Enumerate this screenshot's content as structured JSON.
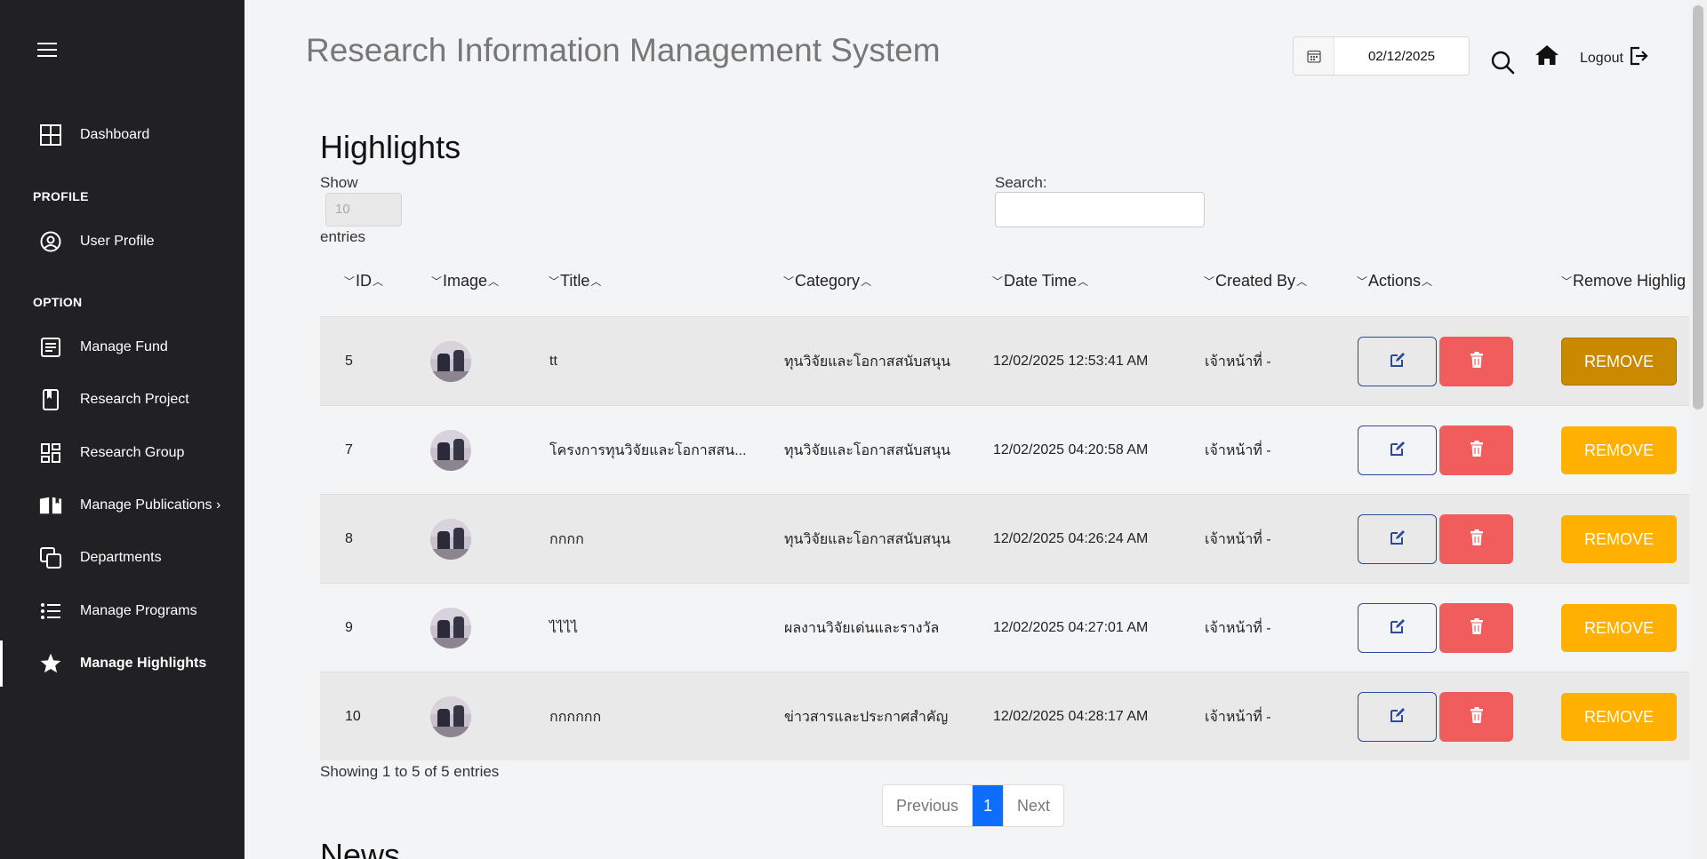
{
  "app": {
    "title": "Research Information Management System"
  },
  "topbar": {
    "date": "02/12/2025",
    "logout_label": "Logout"
  },
  "sidebar": {
    "sections": {
      "profile": "PROFILE",
      "option": "OPTION"
    },
    "items": [
      {
        "label": "Dashboard"
      },
      {
        "label": "User Profile"
      },
      {
        "label": "Manage Fund"
      },
      {
        "label": "Research Project"
      },
      {
        "label": "Research Group"
      },
      {
        "label": "Manage Publications ›"
      },
      {
        "label": "Departments"
      },
      {
        "label": "Manage Programs"
      },
      {
        "label": "Manage Highlights"
      }
    ]
  },
  "main": {
    "heading": "Highlights",
    "show_label": "Show",
    "show_value": "10",
    "entries_label": "entries",
    "search_label": "Search:",
    "search_value": "",
    "columns": [
      "ID",
      "Image",
      "Title",
      "Category",
      "Date Time",
      "Created By",
      "Actions",
      "Remove Highlig"
    ],
    "rows": [
      {
        "id": "5",
        "title": "tt",
        "category": "ทุนวิจัยและโอกาสสนับสนุน",
        "datetime": "12/02/2025 12:53:41 AM",
        "created_by": "เจ้าหน้าที่ -",
        "remove": "REMOVE"
      },
      {
        "id": "7",
        "title": "โครงการทุนวิจัยและโอกาสสน...",
        "category": "ทุนวิจัยและโอกาสสนับสนุน",
        "datetime": "12/02/2025 04:20:58 AM",
        "created_by": "เจ้าหน้าที่ -",
        "remove": "REMOVE"
      },
      {
        "id": "8",
        "title": "กกกก",
        "category": "ทุนวิจัยและโอกาสสนับสนุน",
        "datetime": "12/02/2025 04:26:24 AM",
        "created_by": "เจ้าหน้าที่ -",
        "remove": "REMOVE"
      },
      {
        "id": "9",
        "title": "ไไไไ",
        "category": "ผลงานวิจัยเด่นและรางวัล",
        "datetime": "12/02/2025 04:27:01 AM",
        "created_by": "เจ้าหน้าที่ -",
        "remove": "REMOVE"
      },
      {
        "id": "10",
        "title": "กกกกกก",
        "category": "ข่าวสารและประกาศสำคัญ",
        "datetime": "12/02/2025 04:28:17 AM",
        "created_by": "เจ้าหน้าที่ -",
        "remove": "REMOVE"
      }
    ],
    "info": "Showing 1 to 5 of 5 entries",
    "pagination": {
      "previous": "Previous",
      "current": "1",
      "next": "Next"
    },
    "next_heading": "News"
  },
  "colors": {
    "sidebar_bg": "#212124",
    "remove_btn": "#ffb000",
    "delete_btn": "#f15c5c",
    "edit_border": "#2c4aa0",
    "page_active": "#0d6efd"
  }
}
